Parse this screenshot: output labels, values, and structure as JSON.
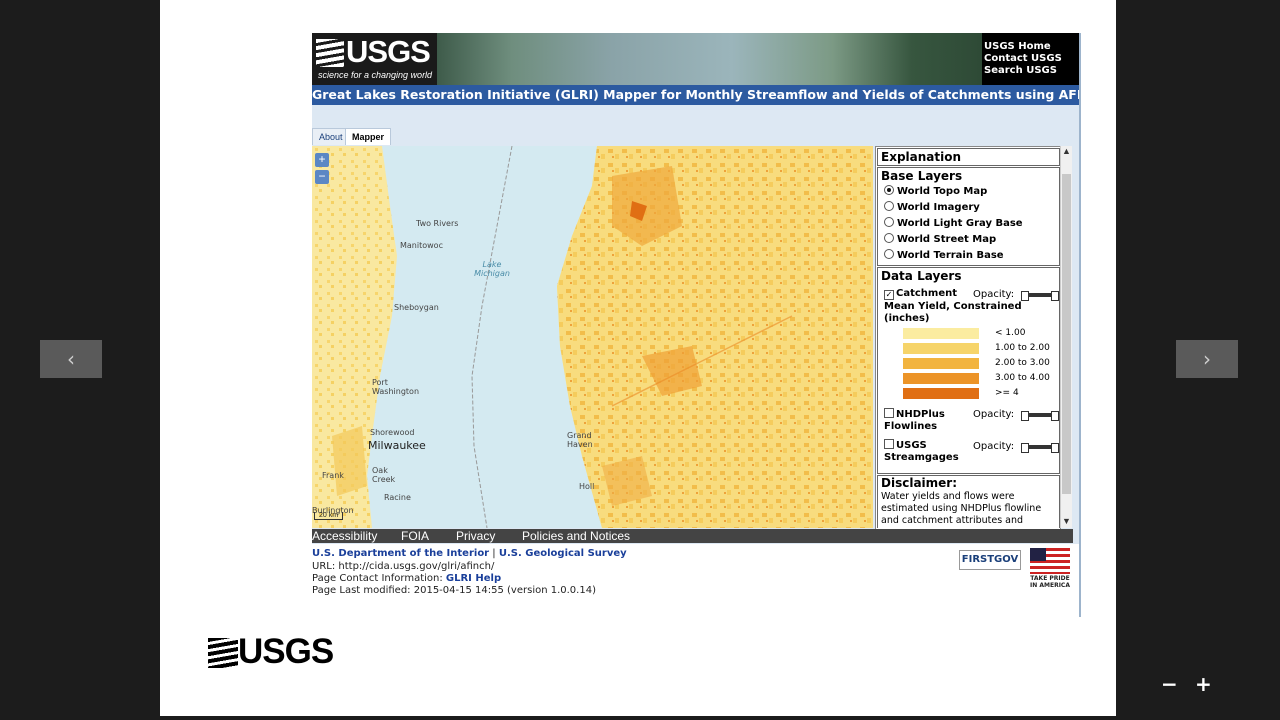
{
  "viewer": {
    "prev_icon": "‹",
    "next_icon": "›",
    "zoom_out": "−",
    "zoom_in": "+",
    "bottom_logo_text": "USGS"
  },
  "banner": {
    "logo_text": "USGS",
    "tagline": "science for a changing world",
    "links": [
      "USGS Home",
      "Contact USGS",
      "Search USGS"
    ]
  },
  "title": "Great Lakes Restoration Initiative (GLRI) Mapper for Monthly Streamflow and Yields of Catchments using AFINCH",
  "tabs": [
    {
      "label": "About",
      "active": false
    },
    {
      "label": "Mapper",
      "active": true
    }
  ],
  "map": {
    "zoom_in": "+",
    "zoom_out": "−",
    "places": [
      {
        "text": "Two Rivers",
        "big": false
      },
      {
        "text": "Manitowoc",
        "big": false
      },
      {
        "text": "Sheboygan",
        "big": false
      },
      {
        "text": "Port Washington",
        "big": false
      },
      {
        "text": "Shorewood",
        "big": false
      },
      {
        "text": "Milwaukee",
        "big": true
      },
      {
        "text": "Oak Creek",
        "big": false
      },
      {
        "text": "Racine",
        "big": false
      },
      {
        "text": "Frank",
        "big": false
      },
      {
        "text": "Burlington",
        "big": false
      },
      {
        "text": "Grand Haven",
        "big": false
      },
      {
        "text": "Holl",
        "big": false
      }
    ],
    "lake_label": "Lake Michigan",
    "scale_label": "20 km"
  },
  "panel": {
    "explanation": "Explanation",
    "base_layers_head": "Base Layers",
    "base_layers": [
      {
        "label": "World Topo Map",
        "selected": true
      },
      {
        "label": "World Imagery",
        "selected": false
      },
      {
        "label": "World Light Gray Base",
        "selected": false
      },
      {
        "label": "World Street Map",
        "selected": false
      },
      {
        "label": "World Terrain Base",
        "selected": false
      }
    ],
    "data_layers_head": "Data Layers",
    "catchment_label": "Catchment",
    "catchment_sub": "Mean Yield, Constrained (inches)",
    "catchment_checked": "✓",
    "opacity_label": "Opacity:",
    "legend": [
      {
        "label": "< 1.00",
        "color": "#fbeca0"
      },
      {
        "label": "1.00 to 2.00",
        "color": "#f6d46a"
      },
      {
        "label": "2.00 to 3.00",
        "color": "#f2b43f"
      },
      {
        "label": "3.00 to 4.00",
        "color": "#ec9428"
      },
      {
        "label": ">= 4",
        "color": "#e06f14"
      }
    ],
    "nhd_label_1": "NHDPlus",
    "nhd_label_2": "Flowlines",
    "streamgages_label_1": "USGS",
    "streamgages_label_2": "Streamgages",
    "disclaimer_head": "Disclaimer:",
    "disclaimer_text": "Water yields and flows were estimated using NHDPlus flowline and catchment attributes and"
  },
  "footer_links": [
    "Accessibility",
    "FOIA",
    "Privacy",
    "Policies and Notices"
  ],
  "bottom": {
    "dept": "U.S. Department of the Interior",
    "sep": " | ",
    "survey": "U.S. Geological Survey",
    "url_label": "URL: ",
    "url": "http://cida.usgs.gov/glri/afinch/",
    "contact_label": "Page Contact Information: ",
    "contact": "GLRI Help",
    "modified": "Page Last modified: 2015-04-15 14:55 (version 1.0.0.14)",
    "firstgov": "FIRSTGOV",
    "take_pride": "TAKE PRIDE IN AMERICA"
  },
  "colors": {
    "title_bar": "#2c5aa0",
    "water": "#d4eaf1",
    "land": "#f6eda2"
  }
}
